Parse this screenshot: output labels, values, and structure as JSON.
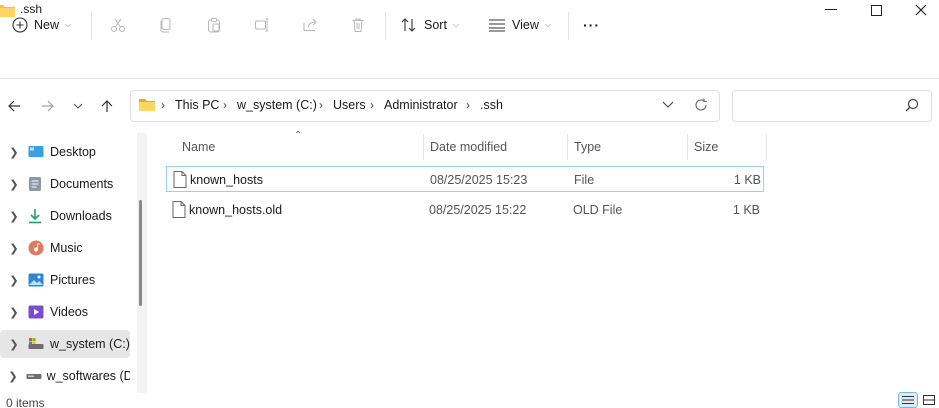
{
  "window": {
    "title": ".ssh"
  },
  "commandbar": {
    "new_label": "New",
    "sort_label": "Sort",
    "view_label": "View",
    "more_label": "···"
  },
  "address": {
    "crumbs": [
      "This PC",
      "w_system (C:)",
      "Users",
      "Administrator",
      ".ssh"
    ]
  },
  "search": {
    "placeholder": ""
  },
  "sidebar": {
    "items": [
      {
        "label": "Desktop",
        "icon": "desktop-icon"
      },
      {
        "label": "Documents",
        "icon": "documents-icon"
      },
      {
        "label": "Downloads",
        "icon": "download-icon"
      },
      {
        "label": "Music",
        "icon": "music-icon"
      },
      {
        "label": "Pictures",
        "icon": "pictures-icon"
      },
      {
        "label": "Videos",
        "icon": "videos-icon"
      },
      {
        "label": "w_system (C:)",
        "icon": "drive-icon"
      },
      {
        "label": "w_softwares (D:",
        "icon": "drive-icon"
      }
    ],
    "selected": "w_system (C:)"
  },
  "columns": {
    "name": "Name",
    "date": "Date modified",
    "type": "Type",
    "size": "Size"
  },
  "files": [
    {
      "name": "known_hosts",
      "date": "08/25/2025 15:23",
      "type": "File",
      "size": "1 KB"
    },
    {
      "name": "known_hosts.old",
      "date": "08/25/2025 15:22",
      "type": "OLD File",
      "size": "1 KB"
    }
  ],
  "status": {
    "items_text": "0 items"
  },
  "colors": {
    "accent": "#0067c0",
    "selection_border": "#99d1e6",
    "folder": "#f5c243"
  }
}
